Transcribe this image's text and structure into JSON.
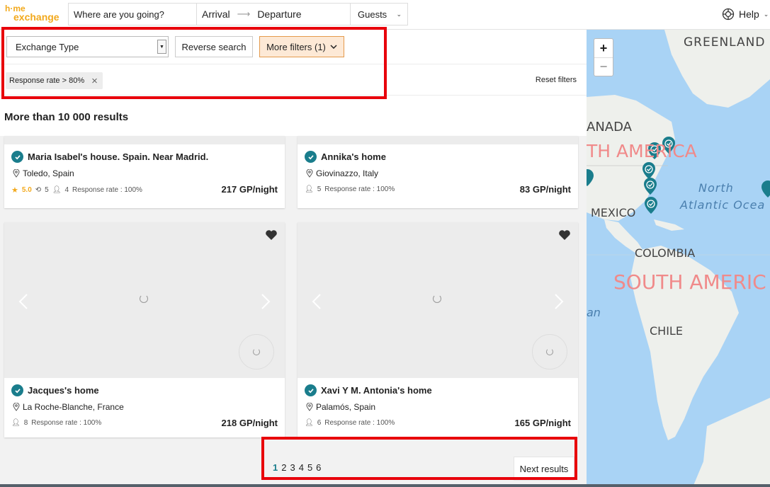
{
  "header": {
    "logo_line1": "h·me",
    "logo_line2": "exchange",
    "where_placeholder": "Where are you going?",
    "arrival": "Arrival",
    "departure": "Departure",
    "guests": "Guests",
    "help": "Help"
  },
  "filters": {
    "exchange_type": "Exchange Type",
    "reverse_search": "Reverse search",
    "more_filters": "More filters (1)",
    "active_chip": "Response rate > 80%",
    "reset": "Reset filters"
  },
  "results": {
    "count_label": "More than 10 000 results",
    "cards": [
      {
        "title": "Maria Isabel's house. Spain. Near Madrid.",
        "location": "Toledo, Spain",
        "rating": "5.0",
        "reviews": "5",
        "guests": "4",
        "response": "Response rate : 100%",
        "price": "217 GP/night"
      },
      {
        "title": "Annika's home",
        "location": "Giovinazzo, Italy",
        "guests": "5",
        "response": "Response rate : 100%",
        "price": "83 GP/night"
      },
      {
        "title": "Jacques's home",
        "location": "La Roche-Blanche, France",
        "guests": "8",
        "response": "Response rate : 100%",
        "price": "218 GP/night"
      },
      {
        "title": "Xavi Y M. Antonia's home",
        "location": "Palamós, Spain",
        "guests": "6",
        "response": "Response rate : 100%",
        "price": "165 GP/night"
      }
    ]
  },
  "pagination": {
    "pages": [
      "1",
      "2",
      "3",
      "4",
      "5",
      "6"
    ],
    "current": "1",
    "next": "Next results"
  },
  "map": {
    "zoom_in": "+",
    "zoom_out": "−",
    "labels": {
      "greenland": "GREENLAND",
      "canada": "ANADA",
      "north_america": "TH AMERICA",
      "north_atlantic_1": "North",
      "north_atlantic_2": "Atlantic Ocea",
      "mexico": "MEXICO",
      "colombia": "COLOMBIA",
      "south_america": "SOUTH AMERIC",
      "ocean_left": "an",
      "chile": "CHILE"
    }
  },
  "colors": {
    "brand": "#f2a91d",
    "teal": "#1a7d8c",
    "highlight": "#e8000b"
  }
}
